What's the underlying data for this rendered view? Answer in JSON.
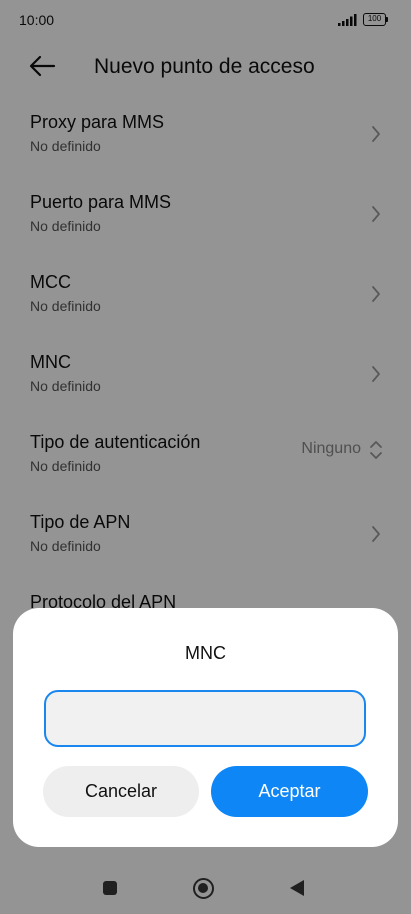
{
  "status_bar": {
    "time": "10:00",
    "battery": "100"
  },
  "header": {
    "title": "Nuevo punto de acceso",
    "back_icon": "arrow-left-icon"
  },
  "settings": [
    {
      "title": "Proxy para MMS",
      "value": "No definido"
    },
    {
      "title": "Puerto para MMS",
      "value": "No definido"
    },
    {
      "title": "MCC",
      "value": "No definido"
    },
    {
      "title": "MNC",
      "value": "No definido"
    },
    {
      "title": "Tipo de autenticación",
      "value": "No definido",
      "selected": "Ninguno"
    },
    {
      "title": "Tipo de APN",
      "value": "No definido"
    },
    {
      "title": "Protocolo del APN"
    }
  ],
  "dialog": {
    "title": "MNC",
    "input_value": "",
    "cancel_label": "Cancelar",
    "accept_label": "Aceptar"
  },
  "colors": {
    "accent": "#0f86f5",
    "input_border": "#1a86f0"
  },
  "nav_icons": [
    "recent-apps-icon",
    "home-icon",
    "back-icon"
  ]
}
